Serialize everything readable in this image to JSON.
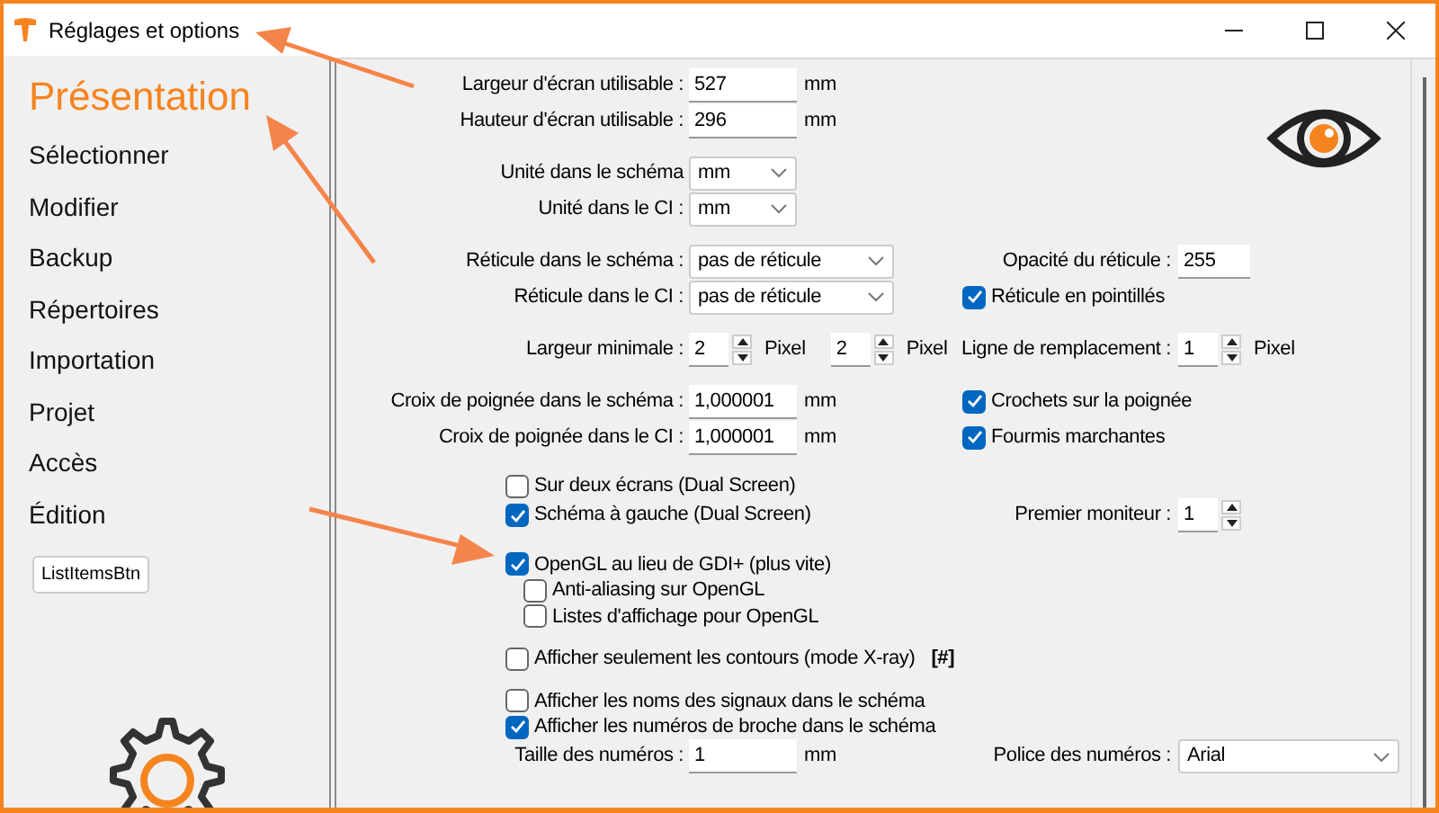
{
  "window": {
    "title": "Réglages et options"
  },
  "sidebar": {
    "items": [
      {
        "label": "Présentation",
        "selected": true
      },
      {
        "label": "Sélectionner",
        "selected": false
      },
      {
        "label": "Modifier",
        "selected": false
      },
      {
        "label": "Backup",
        "selected": false
      },
      {
        "label": "Répertoires",
        "selected": false
      },
      {
        "label": "Importation",
        "selected": false
      },
      {
        "label": "Projet",
        "selected": false
      },
      {
        "label": "Accès",
        "selected": false
      },
      {
        "label": "Édition",
        "selected": false
      }
    ],
    "button": "ListItemsBtn"
  },
  "settings": {
    "groups": [
      {
        "rows": [
          {
            "left": {
              "kind": "input",
              "label": "Largeur d'écran utilisable :",
              "value": "527",
              "unit": "mm"
            }
          },
          {
            "left": {
              "kind": "input",
              "label": "Hauteur d'écran utilisable :",
              "value": "296",
              "unit": "mm"
            }
          }
        ]
      },
      {
        "rows": [
          {
            "left": {
              "kind": "select",
              "label": "Unité dans le schéma",
              "value": "mm"
            }
          },
          {
            "left": {
              "kind": "select",
              "label": "Unité dans le CI :",
              "value": "mm"
            }
          }
        ]
      },
      {
        "rows": [
          {
            "left": {
              "kind": "select",
              "label": "Réticule dans le schéma :",
              "value": "pas de réticule"
            },
            "right": {
              "kind": "input",
              "label": "Opacité du réticule :",
              "value": "255"
            }
          },
          {
            "left": {
              "kind": "select",
              "label": "Réticule dans le CI :",
              "value": "pas de réticule"
            },
            "right": {
              "kind": "checkbox",
              "label": "Réticule en pointillés",
              "checked": true
            }
          }
        ]
      },
      {
        "rows": [
          {
            "left": {
              "kind": "spin",
              "label": "Largeur minimale :",
              "spins": [
                {
                  "value": "2",
                  "unit": "Pixel"
                },
                {
                  "value": "2",
                  "unit": "Pixel"
                }
              ]
            },
            "right": {
              "kind": "spin",
              "label": "Ligne de remplacement :",
              "spins": [
                {
                  "value": "1",
                  "unit": "Pixel"
                }
              ]
            }
          }
        ]
      },
      {
        "rows": [
          {
            "left": {
              "kind": "input",
              "label": "Croix de poignée dans le schéma :",
              "value": "1,000001",
              "unit": "mm"
            },
            "right": {
              "kind": "checkbox",
              "label": "Crochets sur la poignée",
              "checked": true
            }
          },
          {
            "left": {
              "kind": "input",
              "label": "Croix de poignée dans le CI :",
              "value": "1,000001",
              "unit": "mm"
            },
            "right": {
              "kind": "checkbox",
              "label": "Fourmis marchantes",
              "checked": true
            }
          }
        ]
      },
      {
        "rows": [
          {
            "left": {
              "kind": "checkbox",
              "label": "Sur deux écrans (Dual Screen)",
              "checked": false
            }
          },
          {
            "left": {
              "kind": "checkbox",
              "label": "Schéma à gauche (Dual Screen)",
              "checked": true
            },
            "right": {
              "kind": "spin",
              "label": "Premier moniteur :",
              "spins": [
                {
                  "value": "1"
                }
              ]
            }
          }
        ]
      },
      {
        "rows": [
          {
            "left": {
              "kind": "checkbox",
              "label": "OpenGL au lieu de GDI+ (plus vite)",
              "checked": true,
              "children": [
                {
                  "label": "Anti-aliasing sur OpenGL",
                  "checked": false
                },
                {
                  "label": "Listes d'affichage pour OpenGL",
                  "checked": false
                }
              ]
            }
          }
        ]
      },
      {
        "rows": [
          {
            "left": {
              "kind": "checkbox",
              "label": "Afficher seulement les contours (mode X-ray)",
              "checked": false,
              "tag": "[#]"
            }
          }
        ]
      },
      {
        "rows": [
          {
            "left": {
              "kind": "checkbox",
              "label": "Afficher les noms des signaux dans le schéma",
              "checked": false
            }
          },
          {
            "left": {
              "kind": "checkbox",
              "label": "Afficher les numéros de broche dans le schéma",
              "checked": true
            }
          },
          {
            "left": {
              "kind": "input",
              "label": "Taille des numéros :",
              "value": "1",
              "unit": "mm"
            },
            "right": {
              "kind": "select",
              "label": "Police des numéros :",
              "value": "Arial"
            }
          }
        ]
      }
    ]
  }
}
